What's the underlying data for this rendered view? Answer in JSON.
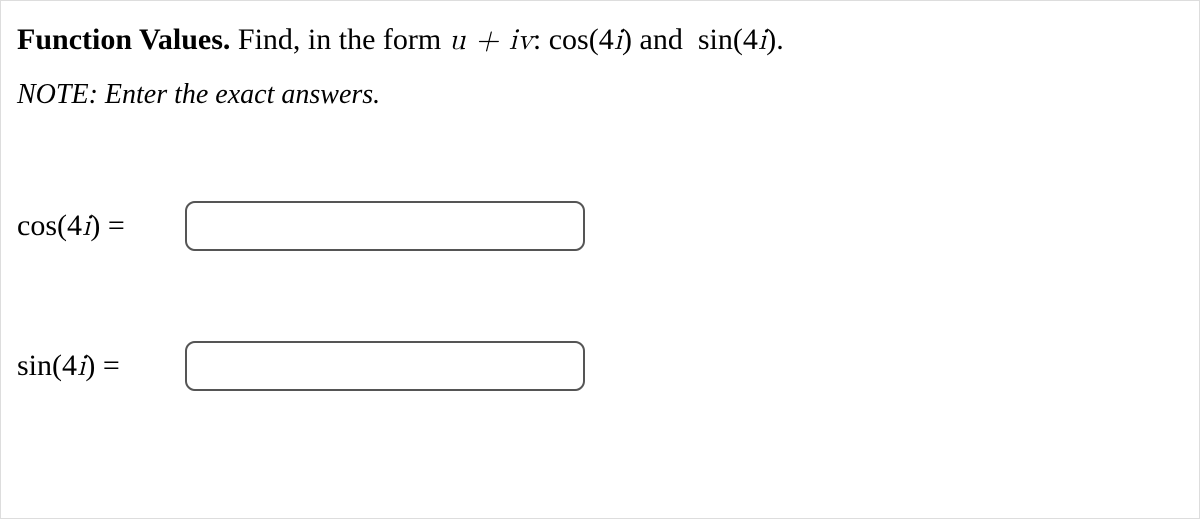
{
  "heading": {
    "title": "Function Values.",
    "prompt_pre": " Find, in the form ",
    "prompt_expr": "u + iv",
    "prompt_post": ": cos(4i) and  sin(4i)."
  },
  "note": "NOTE: Enter the exact answers.",
  "rows": {
    "cos": {
      "func": "cos",
      "arg": "(4i)",
      "equals": " = ",
      "value": ""
    },
    "sin": {
      "func": "sin",
      "arg": "(4i)",
      "equals": " = ",
      "value": ""
    }
  }
}
